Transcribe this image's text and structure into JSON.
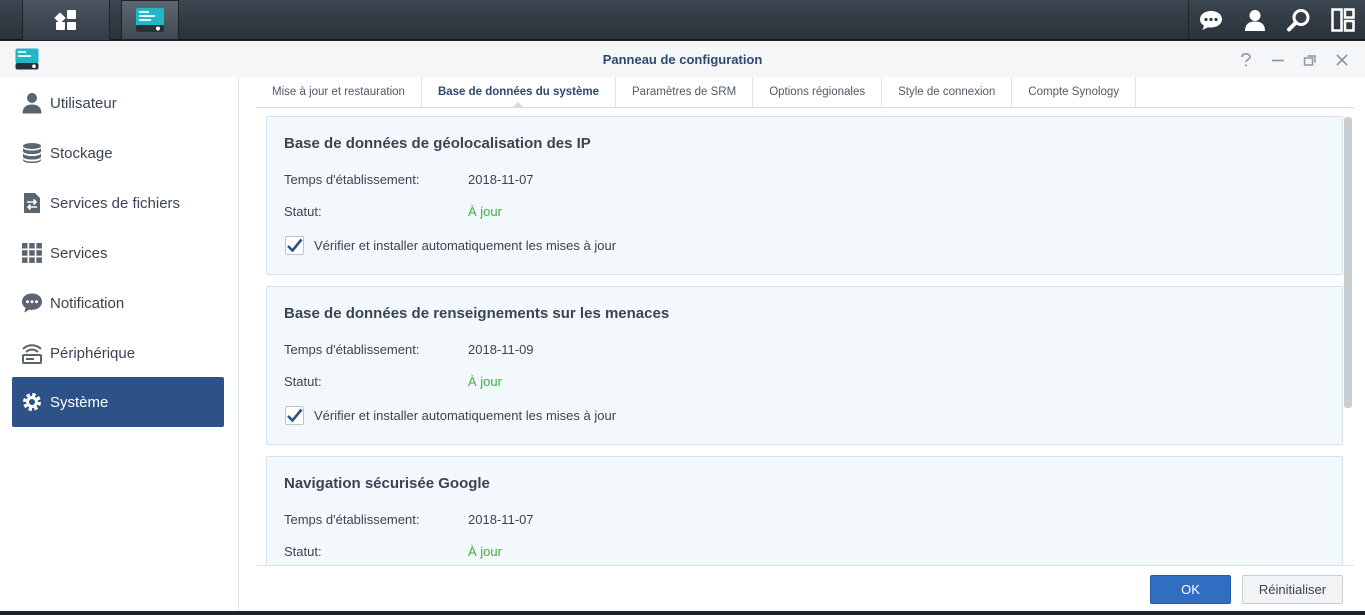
{
  "window": {
    "title": "Panneau de configuration",
    "controls": [
      "help-icon",
      "minimize-icon",
      "restore-icon",
      "close-icon"
    ]
  },
  "sidebar": {
    "items": [
      {
        "label": "Utilisateur",
        "icon": "user-icon"
      },
      {
        "label": "Stockage",
        "icon": "storage-icon"
      },
      {
        "label": "Services de fichiers",
        "icon": "file-services-icon"
      },
      {
        "label": "Services",
        "icon": "services-grid-icon"
      },
      {
        "label": "Notification",
        "icon": "notification-icon"
      },
      {
        "label": "Périphérique",
        "icon": "device-icon"
      },
      {
        "label": "Système",
        "icon": "gear-icon",
        "active": true
      }
    ]
  },
  "tabs": [
    {
      "label": "Mise à jour et restauration"
    },
    {
      "label": "Base de données du système",
      "active": true
    },
    {
      "label": "Paramètres de SRM"
    },
    {
      "label": "Options régionales"
    },
    {
      "label": "Style de connexion"
    },
    {
      "label": "Compte Synology"
    }
  ],
  "panels": [
    {
      "title": "Base de données de géolocalisation des IP",
      "build_time_label": "Temps d'établissement:",
      "build_time": "2018-11-07",
      "status_label": "Statut:",
      "status": "À jour",
      "auto_update_label": "Vérifier et installer automatiquement les mises à jour",
      "auto_update_checked": true
    },
    {
      "title": "Base de données de renseignements sur les menaces",
      "build_time_label": "Temps d'établissement:",
      "build_time": "2018-11-09",
      "status_label": "Statut:",
      "status": "À jour",
      "auto_update_label": "Vérifier et installer automatiquement les mises à jour",
      "auto_update_checked": true
    },
    {
      "title": "Navigation sécurisée Google",
      "build_time_label": "Temps d'établissement:",
      "build_time": "2018-11-07",
      "status_label": "Statut:",
      "status": "À jour"
    }
  ],
  "footer": {
    "ok_label": "OK",
    "reset_label": "Réinitialiser"
  },
  "colors": {
    "accent": "#2c5287",
    "status_ok": "#3bb33b",
    "primary_button": "#2f6ec0"
  }
}
